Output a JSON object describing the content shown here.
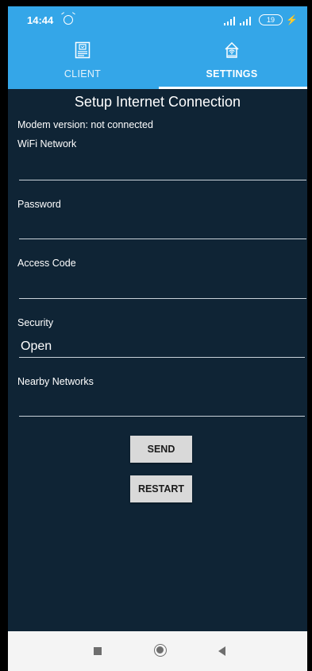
{
  "status_bar": {
    "time": "14:44",
    "battery": "19"
  },
  "tabs": [
    {
      "label": "CLIENT",
      "selected": false
    },
    {
      "label": "SETTINGS",
      "selected": true
    }
  ],
  "colors": {
    "accent": "#34a6e8",
    "background": "#0f2435"
  },
  "settings": {
    "title": "Setup Internet Connection",
    "modem_version": "Modem version: not connected",
    "wifi_label": "WiFi Network",
    "wifi_value": "",
    "password_label": "Password",
    "password_value": "",
    "access_code_label": "Access Code",
    "access_code_value": "",
    "security_label": "Security",
    "security_value": "Open",
    "nearby_label": "Nearby Networks",
    "nearby_value": ""
  },
  "buttons": {
    "send": "SEND",
    "restart": "RESTART"
  }
}
